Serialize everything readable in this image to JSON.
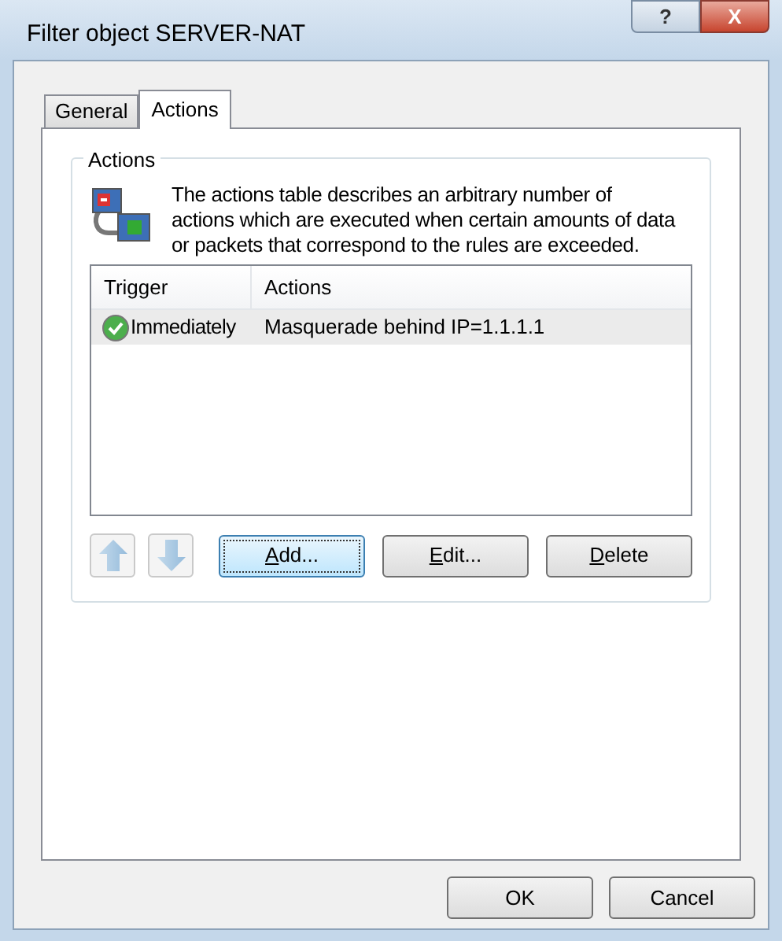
{
  "window": {
    "title": "Filter object SERVER-NAT",
    "controls": [
      "?",
      "X"
    ]
  },
  "tabs": [
    {
      "label": "General",
      "selected": false
    },
    {
      "label": "Actions",
      "selected": true
    }
  ],
  "group": {
    "title": "Actions",
    "description": "The actions table describes an arbitrary number of actions which are executed when certain amounts of data or packets that correspond to the rules are exceeded."
  },
  "table": {
    "columns": [
      "Trigger",
      "Actions"
    ],
    "rows": [
      {
        "trigger": "Immediately",
        "action": "Masquerade behind IP=1.1.1.1",
        "selected": true,
        "enabled": true
      }
    ]
  },
  "move_buttons": [
    {
      "kind": "up",
      "disabled": true
    },
    {
      "kind": "down",
      "disabled": true
    }
  ],
  "buttons": [
    {
      "label": "Add...",
      "mnemonic": true,
      "focused": true
    },
    {
      "label": "Edit...",
      "mnemonic": true,
      "focused": false
    },
    {
      "label": "Delete",
      "mnemonic": true,
      "focused": false
    }
  ],
  "footer_buttons": [
    "OK",
    "Cancel"
  ]
}
